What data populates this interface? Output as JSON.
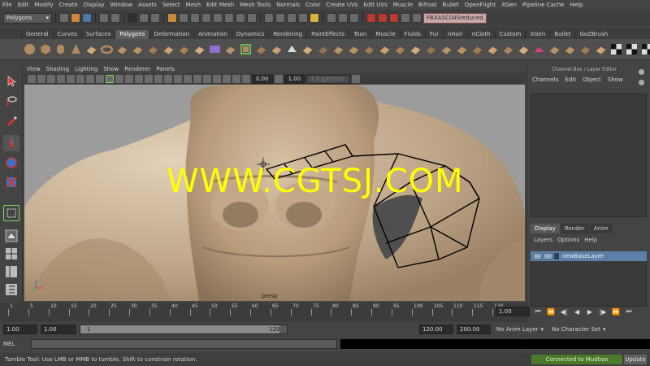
{
  "menubar": [
    "File",
    "Edit",
    "Modify",
    "Create",
    "Display",
    "Window",
    "Assets",
    "Select",
    "Mesh",
    "Edit Mesh",
    "Mesh Tools",
    "Normals",
    "Color",
    "Create UVs",
    "Edit UVs",
    "Muscle",
    "Bifrost",
    "Bullet",
    "OpenFlight",
    "XGen",
    "Pipeline Cache",
    "Help"
  ],
  "statusline": {
    "mode": "Polygons",
    "object_field": "FBXASC04Sreduced"
  },
  "shelf_tabs": [
    "General",
    "Curves",
    "Surfaces",
    "Polygons",
    "Deformation",
    "Animation",
    "Dynamics",
    "Rendering",
    "PaintEffects",
    "Toon",
    "Muscle",
    "Fluids",
    "Fur",
    "nHair",
    "nCloth",
    "Custom",
    "XGen",
    "Bullet",
    "GoZBrush"
  ],
  "shelf_active_tab": "Polygons",
  "panel_menu": [
    "View",
    "Shading",
    "Lighting",
    "Show",
    "Renderer",
    "Panels"
  ],
  "panel_toolbar": {
    "field_a": "0.00",
    "field_b": "1.00",
    "gamma": "1.8 gamma"
  },
  "viewport": {
    "watermark": "WWW.CGTSJ.COM",
    "camera_label": "persp"
  },
  "channel_box": {
    "title": "Channel Box / Layer Editor",
    "menu": [
      "Channels",
      "Edit",
      "Object",
      "Show"
    ]
  },
  "layer_editor": {
    "tabs": [
      "Display",
      "Render",
      "Anim"
    ],
    "active_tab": "Display",
    "menu": [
      "Layers",
      "Options",
      "Help"
    ],
    "layer_name": "newBaseLayer"
  },
  "timeline": {
    "ticks": [
      "1",
      "5",
      "10",
      "15",
      "20",
      "25",
      "30",
      "35",
      "40",
      "45",
      "50",
      "55",
      "60",
      "65",
      "70",
      "75",
      "80",
      "85",
      "90",
      "95",
      "100",
      "105",
      "110",
      "115",
      "120"
    ],
    "current_frame": "1.00"
  },
  "range": {
    "start": "1.00",
    "start2": "1.00",
    "slider_start": "1",
    "slider_end": "120",
    "end": "120.00",
    "end2": "200.00",
    "anim_layer": "No Anim Layer",
    "character_set": "No Character Set"
  },
  "cmd": {
    "label": "MEL"
  },
  "helpline": {
    "text": "Tumble Tool: Use LMB or MMB to tumble. Shift to constrain rotation.",
    "mudbox": "Connected to Mudbox",
    "update": "Update"
  }
}
